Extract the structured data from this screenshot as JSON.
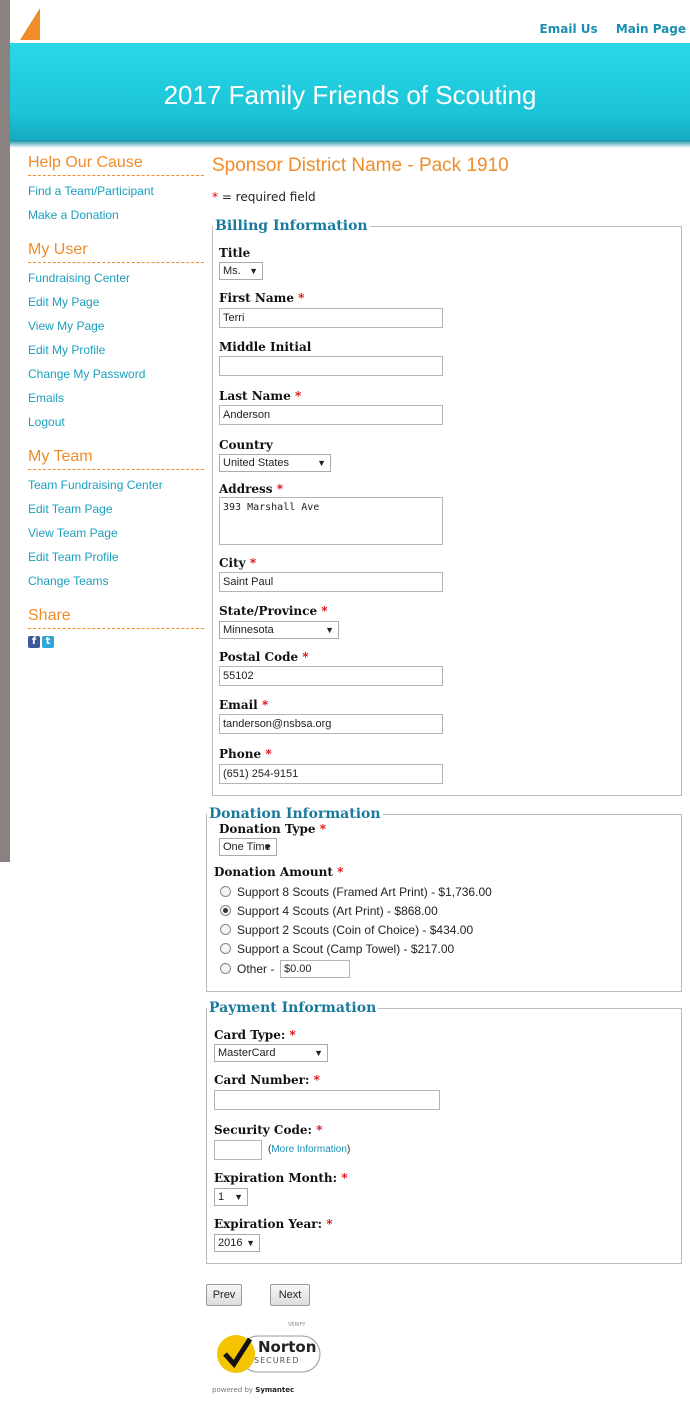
{
  "header": {
    "links": [
      "Email Us",
      "Main Page"
    ],
    "banner_title": "2017 Family Friends of Scouting"
  },
  "sidebar": {
    "sections": [
      {
        "title": "Help Our Cause",
        "links": [
          "Find a Team/Participant",
          "Make a Donation"
        ]
      },
      {
        "title": "My User",
        "links": [
          "Fundraising Center",
          "Edit My Page",
          "View My Page",
          "Edit My Profile",
          "Change My Password",
          "Emails",
          "Logout"
        ]
      },
      {
        "title": "My Team",
        "links": [
          "Team Fundraising Center",
          "Edit Team Page",
          "View Team Page",
          "Edit Team Profile",
          "Change Teams"
        ]
      },
      {
        "title": "Share",
        "links": []
      }
    ],
    "social_icons": [
      "facebook-icon",
      "twitter-icon"
    ]
  },
  "main": {
    "title": "Sponsor District Name - Pack 1910",
    "required_note_star": "*",
    "required_note": " = required field"
  },
  "billing": {
    "legend": "Billing Information",
    "title_label": "Title",
    "title_value": "Ms.",
    "first_name_label": "First Name",
    "first_name_value": "Terri",
    "middle_initial_label": "Middle Initial",
    "middle_initial_value": "",
    "last_name_label": "Last Name",
    "last_name_value": "Anderson",
    "country_label": "Country",
    "country_value": "United States",
    "address_label": "Address",
    "address_value": "393 Marshall Ave",
    "city_label": "City",
    "city_value": "Saint Paul",
    "state_label": "State/Province",
    "state_value": "Minnesota",
    "postal_label": "Postal Code",
    "postal_value": "55102",
    "email_label": "Email",
    "email_value": "tanderson@nsbsa.org",
    "phone_label": "Phone",
    "phone_value": "(651) 254-9151",
    "star": "*"
  },
  "donation": {
    "legend": "Donation Information",
    "type_label": "Donation Type",
    "type_value": "One Time",
    "amount_label": "Donation Amount",
    "options": [
      {
        "label": "Support 8 Scouts (Framed Art Print) - $1,736.00",
        "selected": false
      },
      {
        "label": "Support 4 Scouts (Art Print) - $868.00",
        "selected": true
      },
      {
        "label": "Support 2 Scouts (Coin of Choice) - $434.00",
        "selected": false
      },
      {
        "label": "Support a Scout (Camp Towel) - $217.00",
        "selected": false
      },
      {
        "label": "Other - ",
        "selected": false
      }
    ],
    "other_value": "$0.00"
  },
  "payment": {
    "legend": "Payment Information",
    "card_type_label": "Card Type:",
    "card_type_value": "MasterCard",
    "card_number_label": "Card Number:",
    "card_number_value": "",
    "security_label": "Security Code:",
    "security_value": "",
    "more_info_open": "(",
    "more_info_link": "More Information",
    "more_info_close": ")",
    "exp_month_label": "Expiration Month:",
    "exp_month_value": "1",
    "exp_year_label": "Expiration Year:",
    "exp_year_value": "2016"
  },
  "buttons": {
    "prev": "Prev",
    "next": "Next"
  },
  "badge": {
    "verify": "VERIFY",
    "name": "Norton",
    "secured": "SECURED",
    "powered_by": "powered by ",
    "symantec": "Symantec"
  }
}
